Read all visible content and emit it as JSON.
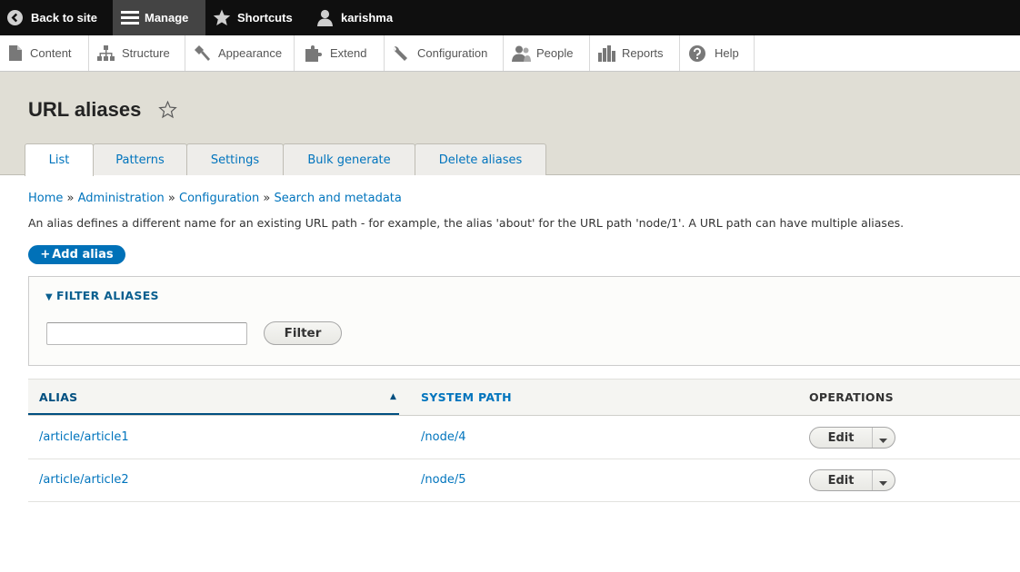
{
  "toolbar": {
    "back_to_site": "Back to site",
    "manage": "Manage",
    "shortcuts": "Shortcuts",
    "user": "karishma"
  },
  "tray": {
    "items": [
      {
        "label": "Content",
        "icon": "page-icon"
      },
      {
        "label": "Structure",
        "icon": "sitemap-icon"
      },
      {
        "label": "Appearance",
        "icon": "paintbrush-icon"
      },
      {
        "label": "Extend",
        "icon": "puzzle-icon"
      },
      {
        "label": "Configuration",
        "icon": "wrench-icon"
      },
      {
        "label": "People",
        "icon": "people-icon"
      },
      {
        "label": "Reports",
        "icon": "bar-chart-icon"
      },
      {
        "label": "Help",
        "icon": "help-icon"
      }
    ]
  },
  "page": {
    "title": "URL aliases",
    "tabs": [
      "List",
      "Patterns",
      "Settings",
      "Bulk generate",
      "Delete aliases"
    ],
    "active_tab": "List"
  },
  "breadcrumb": {
    "items": [
      "Home",
      "Administration",
      "Configuration",
      "Search and metadata"
    ],
    "separator": "»"
  },
  "description": "An alias defines a different name for an existing URL path - for example, the alias 'about' for the URL path 'node/1'. A URL path can have multiple aliases.",
  "add_alias": {
    "plus": "+",
    "label": "Add alias"
  },
  "filter": {
    "legend": "FILTER ALIASES",
    "arrow": "▼",
    "input_value": "",
    "button_label": "Filter"
  },
  "table": {
    "headers": {
      "alias": "ALIAS",
      "system_path": "SYSTEM PATH",
      "operations": "OPERATIONS"
    },
    "sort_indicator": "▲",
    "rows": [
      {
        "alias": "/article/article1",
        "system_path": "/node/4",
        "operation": "Edit"
      },
      {
        "alias": "/article/article2",
        "system_path": "/node/5",
        "operation": "Edit"
      }
    ]
  },
  "colors": {
    "toolbar_bg": "#0f0f0f",
    "active_toolbar": "#444444",
    "link": "#0074bd",
    "primary_button": "#0071b8",
    "header_bg": "#e0ded5"
  }
}
